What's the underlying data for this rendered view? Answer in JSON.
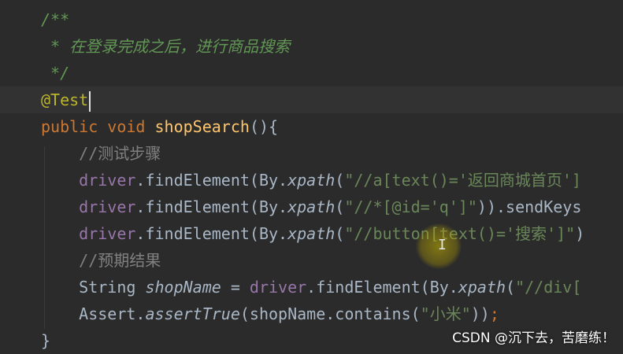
{
  "editor": {
    "lines": [
      {
        "indent": "",
        "tokens": [
          {
            "t": "/**",
            "c": "doc"
          }
        ]
      },
      {
        "indent": " ",
        "tokens": [
          {
            "t": "* ",
            "c": "doc"
          },
          {
            "t": "在登录完成之后，进行商品搜索",
            "c": "doc cn"
          }
        ]
      },
      {
        "indent": " ",
        "tokens": [
          {
            "t": "*/",
            "c": "doc"
          }
        ]
      },
      {
        "indent": "",
        "tokens": [
          {
            "t": "@Test",
            "c": "anno"
          }
        ],
        "current": true,
        "caret": true
      },
      {
        "indent": "",
        "tokens": [
          {
            "t": "public",
            "c": "kw"
          },
          {
            "t": " "
          },
          {
            "t": "void",
            "c": "kw"
          },
          {
            "t": " "
          },
          {
            "t": "shopSearch",
            "c": "fn"
          },
          {
            "t": "(){"
          }
        ]
      },
      {
        "indent": "    ",
        "tokens": [
          {
            "t": "//",
            "c": "cmt"
          },
          {
            "t": "测试步骤",
            "c": "cmt cn"
          }
        ]
      },
      {
        "indent": "    ",
        "tokens": [
          {
            "t": "driver",
            "c": "field"
          },
          {
            "t": ".findElement(By."
          },
          {
            "t": "xpath",
            "c": "ital"
          },
          {
            "t": "("
          },
          {
            "t": "\"//a[text()='",
            "c": "str"
          },
          {
            "t": "返回商城首页",
            "c": "str cn"
          },
          {
            "t": "']",
            "c": "str"
          }
        ]
      },
      {
        "indent": "    ",
        "tokens": [
          {
            "t": "driver",
            "c": "field"
          },
          {
            "t": ".findElement(By."
          },
          {
            "t": "xpath",
            "c": "ital"
          },
          {
            "t": "("
          },
          {
            "t": "\"//*[@id='q']\"",
            "c": "str"
          },
          {
            "t": ")).sendKeys"
          }
        ]
      },
      {
        "indent": "    ",
        "tokens": [
          {
            "t": "driver",
            "c": "field"
          },
          {
            "t": ".findElement(By."
          },
          {
            "t": "xpath",
            "c": "ital"
          },
          {
            "t": "("
          },
          {
            "t": "\"//button[text()='",
            "c": "str"
          },
          {
            "t": "搜索",
            "c": "str cn"
          },
          {
            "t": "']\"",
            "c": "str"
          },
          {
            "t": ")"
          }
        ]
      },
      {
        "indent": "    ",
        "tokens": [
          {
            "t": "//",
            "c": "cmt"
          },
          {
            "t": "预期结果",
            "c": "cmt cn"
          }
        ]
      },
      {
        "indent": "    ",
        "tokens": [
          {
            "t": "String "
          },
          {
            "t": "shopName",
            "c": "ital"
          },
          {
            "t": " = "
          },
          {
            "t": "driver",
            "c": "field"
          },
          {
            "t": ".findElement(By."
          },
          {
            "t": "xpath",
            "c": "ital"
          },
          {
            "t": "("
          },
          {
            "t": "\"//div[",
            "c": "str"
          }
        ]
      },
      {
        "indent": "    ",
        "tokens": [
          {
            "t": "Assert."
          },
          {
            "t": "assertTrue",
            "c": "ital"
          },
          {
            "t": "(shopName.contains("
          },
          {
            "t": "\"",
            "c": "str"
          },
          {
            "t": "小米",
            "c": "str cn"
          },
          {
            "t": "\"",
            "c": "str"
          },
          {
            "t": "))"
          },
          {
            "t": ";",
            "c": "kw"
          }
        ]
      },
      {
        "indent": "",
        "tokens": [
          {
            "t": "}"
          }
        ]
      }
    ]
  },
  "watermark": "CSDN @沉下去，苦磨练！",
  "icons": {
    "mouse_cursor": "text-cursor-icon"
  },
  "colors": {
    "background": "#2b2b2b",
    "current_line": "#323232",
    "keyword": "#cc7832",
    "method_decl": "#ffc66d",
    "field": "#9876aa",
    "string": "#6a8759",
    "comment": "#808080",
    "doc_comment": "#629755",
    "annotation": "#bbb529",
    "default_text": "#a9b7c6"
  }
}
